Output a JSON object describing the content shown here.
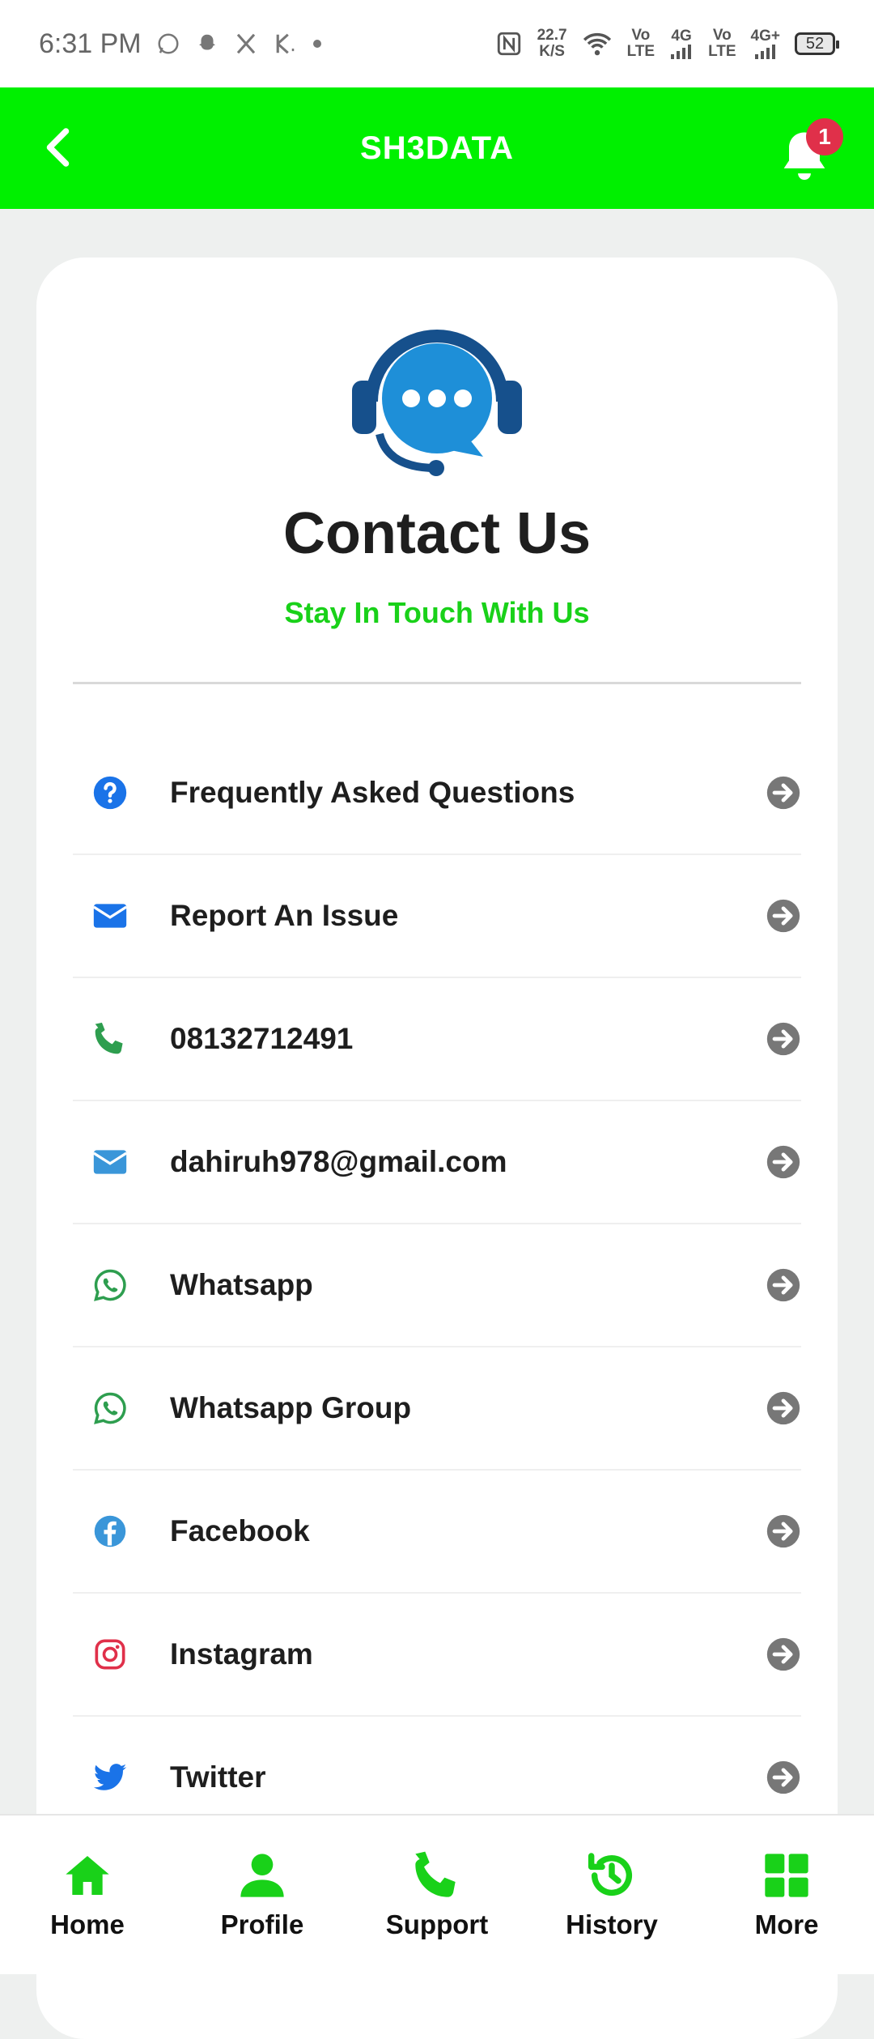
{
  "status_bar": {
    "time": "6:31 PM",
    "net_speed_value": "22.7",
    "net_speed_unit": "K/S",
    "volte1_top": "Vo",
    "volte1_bottom": "LTE",
    "signal1": "4G",
    "volte2_top": "Vo",
    "volte2_bottom": "LTE",
    "signal2": "4G+",
    "battery": "52"
  },
  "app_bar": {
    "title": "SH3DATA",
    "notification_count": "1"
  },
  "header": {
    "title": "Contact Us",
    "subtitle": "Stay In Touch With Us"
  },
  "menu": {
    "items": [
      {
        "label": "Frequently Asked Questions",
        "icon": "question-circle-icon",
        "color": "#1a73e8"
      },
      {
        "label": "Report An Issue",
        "icon": "envelope-icon",
        "color": "#1a73e8"
      },
      {
        "label": "08132712491",
        "icon": "phone-icon",
        "color": "#2e9e4f"
      },
      {
        "label": "dahiruh978@gmail.com",
        "icon": "envelope-icon",
        "color": "#3a96d9"
      },
      {
        "label": "Whatsapp",
        "icon": "whatsapp-icon",
        "color": "#2e9e4f"
      },
      {
        "label": "Whatsapp Group",
        "icon": "whatsapp-icon",
        "color": "#2e9e4f"
      },
      {
        "label": "Facebook",
        "icon": "facebook-icon",
        "color": "#3a96d9"
      },
      {
        "label": "Instagram",
        "icon": "instagram-icon",
        "color": "#e0304a"
      },
      {
        "label": "Twitter",
        "icon": "twitter-icon",
        "color": "#1a73e8"
      }
    ]
  },
  "bottom_nav": {
    "items": [
      {
        "label": "Home",
        "icon": "home-icon"
      },
      {
        "label": "Profile",
        "icon": "user-icon"
      },
      {
        "label": "Support",
        "icon": "phone-icon"
      },
      {
        "label": "History",
        "icon": "history-icon"
      },
      {
        "label": "More",
        "icon": "grid-icon"
      }
    ]
  },
  "colors": {
    "brand_green": "#00f000",
    "subtitle_green": "#19d119",
    "badge_red": "#e0304a",
    "arrow_gray": "#777777"
  }
}
